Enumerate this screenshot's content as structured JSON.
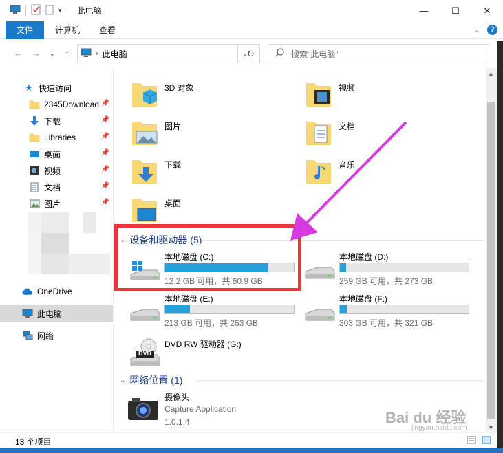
{
  "window": {
    "title": "此电脑",
    "min": "—",
    "max": "☐",
    "close": "✕"
  },
  "ribbon": {
    "tabs": [
      "文件",
      "计算机",
      "查看"
    ]
  },
  "nav": {
    "address": "此电脑",
    "search_placeholder": "搜索\"此电脑\""
  },
  "sidebar": {
    "quick_access": "快速访问",
    "items": [
      {
        "label": "2345Download",
        "icon": "folder-icon"
      },
      {
        "label": "下载",
        "icon": "download-icon"
      },
      {
        "label": "Libraries",
        "icon": "folder-icon"
      },
      {
        "label": "桌面",
        "icon": "desktop-icon"
      },
      {
        "label": "视频",
        "icon": "video-icon"
      },
      {
        "label": "文档",
        "icon": "document-icon"
      },
      {
        "label": "图片",
        "icon": "picture-icon"
      }
    ],
    "onedrive": "OneDrive",
    "this_pc": "此电脑",
    "network": "网络"
  },
  "folders": [
    {
      "name": "3D 对象",
      "icon": "3d-objects-icon"
    },
    {
      "name": "视频",
      "icon": "videos-folder-icon"
    },
    {
      "name": "图片",
      "icon": "pictures-folder-icon"
    },
    {
      "name": "文档",
      "icon": "documents-folder-icon"
    },
    {
      "name": "下载",
      "icon": "downloads-folder-icon"
    },
    {
      "name": "音乐",
      "icon": "music-folder-icon"
    },
    {
      "name": "桌面",
      "icon": "desktop-folder-icon"
    }
  ],
  "devices": {
    "header": "设备和驱动器 (5)",
    "drives": [
      {
        "name": "本地磁盘 (C:)",
        "free": "12.2 GB 可用，共 60.9 GB",
        "used_fraction": 0.8
      },
      {
        "name": "本地磁盘 (D:)",
        "free": "259 GB 可用，共 273 GB",
        "used_fraction": 0.05
      },
      {
        "name": "本地磁盘 (E:)",
        "free": "213 GB 可用，共 263 GB",
        "used_fraction": 0.19
      },
      {
        "name": "本地磁盘 (F:)",
        "free": "303 GB 可用，共 321 GB",
        "used_fraction": 0.056
      }
    ],
    "dvd": {
      "name": "DVD RW 驱动器 (G:)",
      "label": "DVD"
    }
  },
  "network_locations": {
    "header": "网络位置 (1)",
    "item": {
      "name": "摄像头",
      "sub1": "Capture Application",
      "sub2": "1.0.1.4"
    }
  },
  "status": {
    "count": "13 个项目"
  },
  "watermark": {
    "text": "Bai du 经验",
    "sub": "jingyan.baidu.com"
  },
  "colors": {
    "accent": "#1979ca",
    "bar_fill": "#26a0da",
    "annotation": "#e8373a",
    "arrow": "#d63ae0"
  }
}
